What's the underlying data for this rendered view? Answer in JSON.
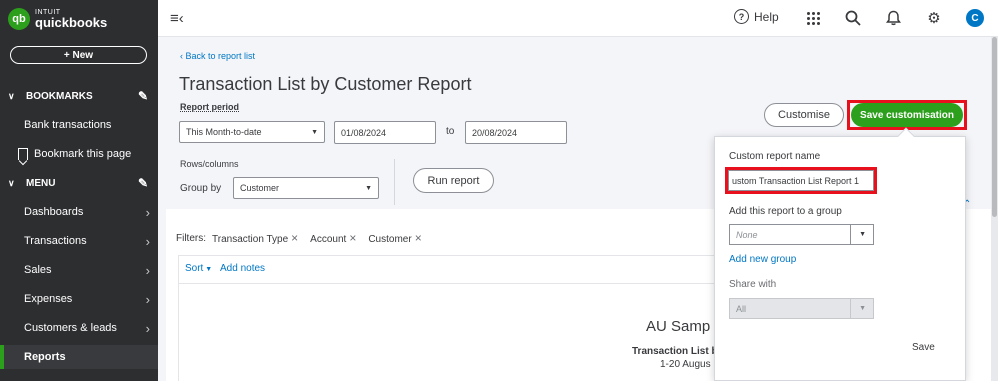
{
  "brand": {
    "badge": "qb",
    "intuit": "INTUIT",
    "name": "quickbooks"
  },
  "sidebar": {
    "new_label": "+  New",
    "bookmarks_label": "BOOKMARKS",
    "bookmark_items": [
      {
        "label": "Bank transactions"
      },
      {
        "label": "Bookmark this page"
      }
    ],
    "menu_label": "MENU",
    "menu_items": [
      {
        "label": "Dashboards"
      },
      {
        "label": "Transactions"
      },
      {
        "label": "Sales"
      },
      {
        "label": "Expenses"
      },
      {
        "label": "Customers & leads"
      },
      {
        "label": "Reports"
      }
    ]
  },
  "topbar": {
    "help_label": "Help",
    "avatar_initial": "C"
  },
  "report": {
    "back_link": "Back to report list",
    "title": "Transaction List by Customer Report",
    "period_label": "Report period",
    "period_value": "This Month-to-date",
    "from_date": "01/08/2024",
    "to_label": "to",
    "to_date": "20/08/2024",
    "rows_columns_label": "Rows/columns",
    "group_by_label": "Group by",
    "group_by_value": "Customer",
    "run_report_label": "Run report",
    "customise_label": "Customise",
    "save_customisation_label": "Save customisation",
    "filters_label": "Filters:",
    "filter_chips": [
      "Transaction Type",
      "Account",
      "Customer"
    ],
    "sort_label": "Sort",
    "add_notes_label": "Add notes",
    "company_name": "AU Samp",
    "report_name": "Transaction List b",
    "report_dates": "1-20 Augus"
  },
  "popover": {
    "custom_name_label": "Custom report name",
    "custom_name_value": "ustom Transaction List Report 1",
    "group_label": "Add this report to a group",
    "group_placeholder": "None",
    "new_group_link": "Add new group",
    "share_label": "Share with",
    "share_value": "All",
    "save_label": "Save"
  },
  "colors": {
    "brand_green": "#2ca01c",
    "link_blue": "#0077c5",
    "highlight_red": "#e8101c",
    "sidebar_bg": "#2d2e30"
  }
}
